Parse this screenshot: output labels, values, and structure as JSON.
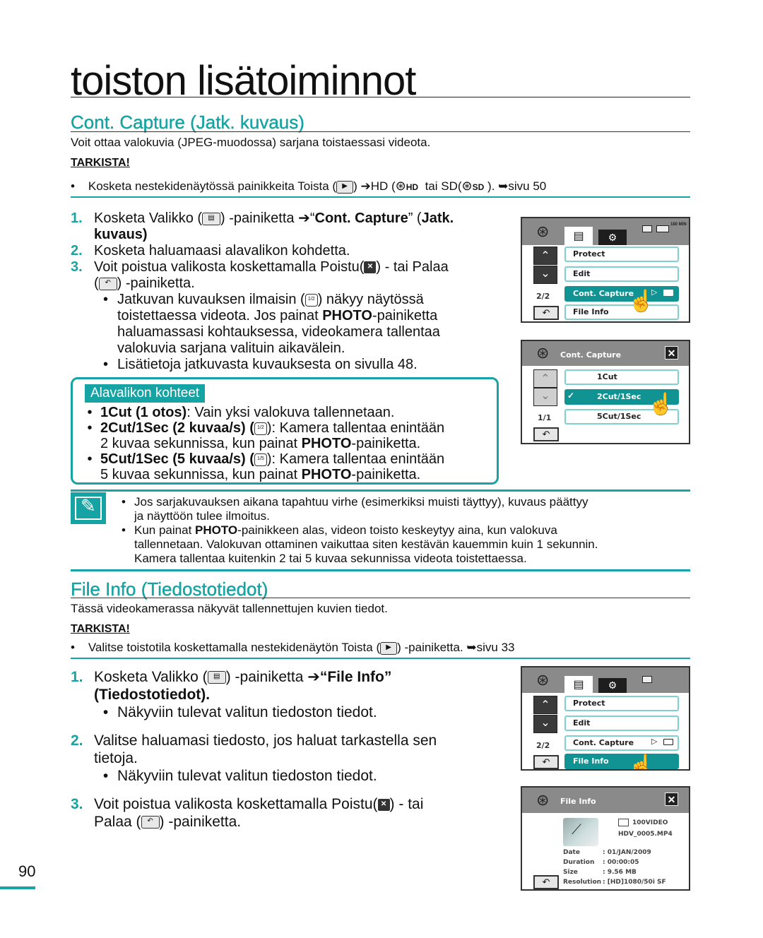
{
  "page": {
    "title": "toiston lisätoiminnot",
    "page_number": "90",
    "accent_color": "#16a3a3"
  },
  "cont_capture": {
    "heading": "Cont. Capture (Jatk. kuvaus)",
    "intro": "Voit ottaa valokuvia (JPEG-muodossa) sarjana toistaessasi videota.",
    "check_label": "TARKISTA!",
    "check_text": "Kosketa nestekidenäytössä painikkeita Toista (",
    "check_text_2": ") ➔HD (",
    "check_text_hd": "HD",
    "check_text_3": "tai SD(",
    "check_text_sd": "SD",
    "check_text_4": "). ➥sivu 50",
    "steps": [
      {
        "num": "1.",
        "pre": "Kosketa Valikko (",
        "mid": ") -painiketta ➔“",
        "bold1": "Cont. Capture",
        "mid2": "” (",
        "bold2": "Jatk.",
        "line2": "kuvaus)"
      },
      {
        "num": "2.",
        "text": "Kosketa haluamaasi alavalikon kohdetta."
      },
      {
        "num": "3.",
        "pre": "Voit poistua valikosta koskettamalla Poistu(",
        "mid": ") - tai Palaa",
        "line2_pre": "(",
        "line2_post": ") -painiketta."
      }
    ],
    "bullets": [
      {
        "pre": "Jatkuvan kuvauksen ilmaisin (",
        "post": ") näkyy näytössä",
        "l2_pre": "toistettaessa videota. Jos painat ",
        "l2_bold": "PHOTO",
        "l2_post": "-painiketta",
        "l3": "haluamassasi kohtauksessa, videokamera tallentaa",
        "l4": "valokuvia sarjana valituin aikavälein."
      },
      {
        "text": "Lisätietoja jatkuvasta kuvauksesta on sivulla 48."
      }
    ],
    "submenu": {
      "label": "Alavalikon kohteet",
      "items": [
        {
          "bold": "1Cut (1 otos)",
          "text": ": Vain yksi valokuva tallennetaan."
        },
        {
          "bold": "2Cut/1Sec (2 kuvaa/s)",
          "open": " (",
          "text": "): Kamera tallentaa enintään",
          "l2_pre": "2 kuvaa sekunnissa, kun painat ",
          "l2_bold": "PHOTO",
          "l2_post": "-painiketta.",
          "icon": "1/2"
        },
        {
          "bold": "5Cut/1Sec (5 kuvaa/s)",
          "open": " (",
          "text": "): Kamera tallentaa enintään",
          "l2_pre": "5 kuvaa sekunnissa, kun painat ",
          "l2_bold": "PHOTO",
          "l2_post": "-painiketta.",
          "icon": "1/5"
        }
      ]
    },
    "notes": [
      {
        "l1": "Jos sarjakuvauksen aikana tapahtuu virhe (esimerkiksi muisti täyttyy), kuvaus päättyy",
        "l2": "ja näyttöön tulee ilmoitus."
      },
      {
        "l1_pre": "Kun painat ",
        "l1_bold": "PHOTO",
        "l1_post": "-painikkeen alas, videon toisto keskeytyy aina, kun valokuva",
        "l2": "tallennetaan. Valokuvan ottaminen vaikuttaa siten kestävän kauemmin kuin 1 sekunnin.",
        "l3": "Kamera tallentaa kuitenkin 2 tai 5 kuvaa sekunnissa videota toistettaessa."
      }
    ],
    "screen1": {
      "items": [
        "Protect",
        "Edit",
        "Cont. Capture",
        "File Info"
      ],
      "selected": "Cont. Capture",
      "page": "2/2",
      "status": "180 MIN"
    },
    "screen2": {
      "title": "Cont. Capture",
      "items": [
        "1Cut",
        "2Cut/1Sec",
        "5Cut/1Sec"
      ],
      "selected": "2Cut/1Sec",
      "page": "1/1"
    }
  },
  "file_info": {
    "heading": "File Info (Tiedostotiedot)",
    "intro": "Tässä videokamerassa näkyvät tallennettujen kuvien tiedot.",
    "check_label": "TARKISTA!",
    "check_pre": "Valitse toistotila koskettamalla nestekidenäytön Toista (",
    "check_post": ") -painiketta. ➥sivu 33",
    "steps": [
      {
        "num": "1.",
        "pre": "Kosketa Valikko (",
        "mid": ") -painiketta ➔",
        "bold1": "“File Info”",
        "line2": "(Tiedostotiedot).",
        "bullet": "Näkyviin tulevat valitun tiedoston tiedot."
      },
      {
        "num": "2.",
        "l1": "Valitse haluamasi tiedosto, jos haluat tarkastella sen",
        "l2": "tietoja.",
        "bullet": "Näkyviin tulevat valitun tiedoston tiedot."
      },
      {
        "num": "3.",
        "pre": "Voit poistua valikosta koskettamalla Poistu(",
        "mid": ") - tai",
        "l2_pre": "Palaa (",
        "l2_post": ") -painiketta."
      }
    ],
    "screen1": {
      "items": [
        "Protect",
        "Edit",
        "Cont. Capture",
        "File Info"
      ],
      "selected": "File Info",
      "page": "2/2"
    },
    "screen2": {
      "title": "File Info",
      "folder": "100VIDEO",
      "filename": "HDV_0005.MP4",
      "fields": [
        {
          "label": "Date",
          "value": ": 01/JAN/2009"
        },
        {
          "label": "Duration",
          "value": ": 00:00:05"
        },
        {
          "label": "Size",
          "value": ": 9.56 MB"
        },
        {
          "label": "Resolution",
          "value": ": [HD]1080/50i SF"
        }
      ]
    }
  },
  "icons": {
    "bullet": "•",
    "up": "⌃",
    "down": "⌄",
    "back": "↶",
    "close": "✕",
    "play_triangle": "▷",
    "check": "✓",
    "gear": "⚙",
    "menu": "▤",
    "folder": "🗀"
  }
}
